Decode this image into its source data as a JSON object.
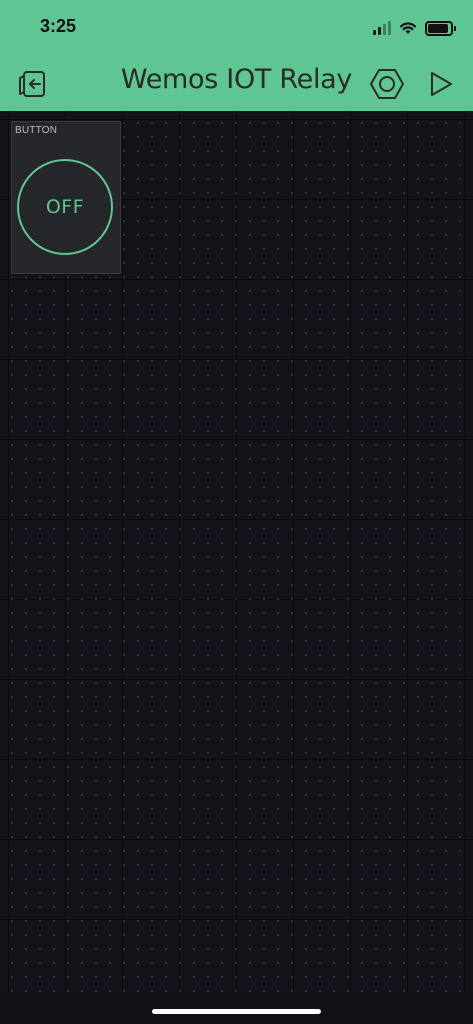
{
  "status_bar": {
    "time": "3:25"
  },
  "header": {
    "title": "Wemos IOT Relay",
    "icons": {
      "back": "exit-icon",
      "settings": "hexagon-settings-icon",
      "play": "play-icon"
    }
  },
  "widgets": [
    {
      "type": "button",
      "label": "BUTTON",
      "state": "OFF"
    }
  ],
  "colors": {
    "accent": "#5fc592",
    "background": "#111217",
    "widget": "#26272b"
  }
}
